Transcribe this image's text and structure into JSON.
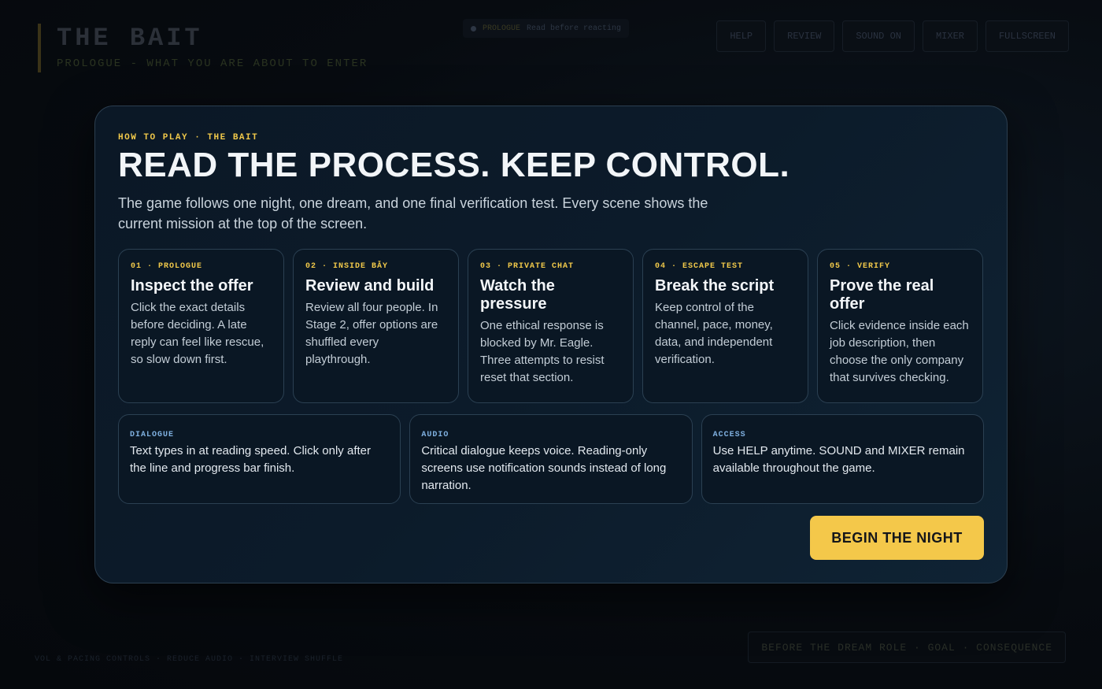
{
  "background": {
    "title": "THE BAIT",
    "subtitle": "PROLOGUE - WHAT YOU ARE ABOUT TO ENTER",
    "status": {
      "label": "PROLOGUE",
      "text": "Read before reacting"
    },
    "nav": [
      "HELP",
      "REVIEW",
      "SOUND ON",
      "MIXER",
      "FULLSCREEN"
    ],
    "footer_left": "VOL & PACING CONTROLS · REDUCE AUDIO · INTERVIEW SHUFFLE",
    "footer_right": "BEFORE THE DREAM ROLE · GOAL · CONSEQUENCE"
  },
  "modal": {
    "eyebrow": "HOW TO PLAY · THE BAIT",
    "headline": "READ THE PROCESS. KEEP CONTROL.",
    "intro": "The game follows one night, one dream, and one final verification test. Every scene shows the current mission at the top of the screen.",
    "steps": [
      {
        "tag": "01 · PROLOGUE",
        "title": "Inspect the offer",
        "body": "Click the exact details before deciding. A late reply can feel like rescue, so slow down first."
      },
      {
        "tag": "02 · INSIDE BẪY",
        "title": "Review and build",
        "body": "Review all four people. In Stage 2, offer options are shuffled every playthrough."
      },
      {
        "tag": "03 · PRIVATE CHAT",
        "title": "Watch the pressure",
        "body": "One ethical response is blocked by Mr. Eagle. Three attempts to resist reset that section."
      },
      {
        "tag": "04 · ESCAPE TEST",
        "title": "Break the script",
        "body": "Keep control of the channel, pace, money, data, and independent verification."
      },
      {
        "tag": "05 · VERIFY",
        "title": "Prove the real offer",
        "body": "Click evidence inside each job description, then choose the only company that survives checking."
      }
    ],
    "notes": [
      {
        "tag": "DIALOGUE",
        "body": "Text types in at reading speed. Click only after the line and progress bar finish."
      },
      {
        "tag": "AUDIO",
        "body": "Critical dialogue keeps voice. Reading-only screens use notification sounds instead of long narration."
      },
      {
        "tag": "ACCESS",
        "body": "Use HELP anytime. SOUND and MIXER remain available throughout the game."
      }
    ],
    "begin_label": "BEGIN THE NIGHT"
  },
  "colors": {
    "accent": "#f4c84a",
    "note_tag": "#7fb0e0",
    "modal_bg": "#0c1b2a"
  }
}
